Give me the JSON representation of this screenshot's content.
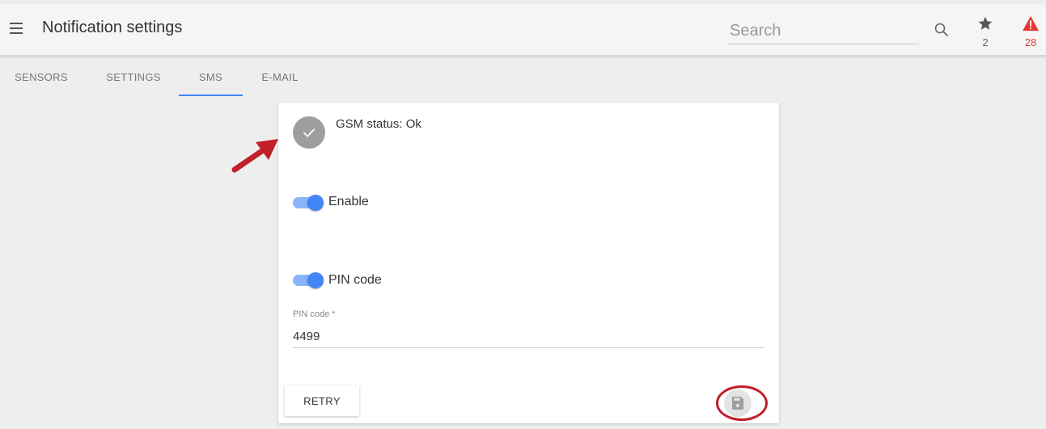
{
  "header": {
    "title": "Notification settings",
    "search_placeholder": "Search",
    "favorites_count": "2",
    "alerts_count": "28"
  },
  "tabs": [
    {
      "label": "SENSORS",
      "active": false
    },
    {
      "label": "SETTINGS",
      "active": false
    },
    {
      "label": "SMS",
      "active": true
    },
    {
      "label": "E-MAIL",
      "active": false
    }
  ],
  "card": {
    "gsm_status": "GSM status: Ok",
    "enable_label": "Enable",
    "enable_on": true,
    "pin_toggle_label": "PIN code",
    "pin_toggle_on": true,
    "pin_field_label": "PIN code *",
    "pin_value": "4499",
    "retry_label": "RETRY"
  },
  "colors": {
    "accent": "#4285f4",
    "alert": "#e53935",
    "annotation": "#c0202a"
  },
  "icons": [
    "menu-icon",
    "search-icon",
    "star-icon",
    "warning-icon",
    "check-icon",
    "save-icon"
  ]
}
